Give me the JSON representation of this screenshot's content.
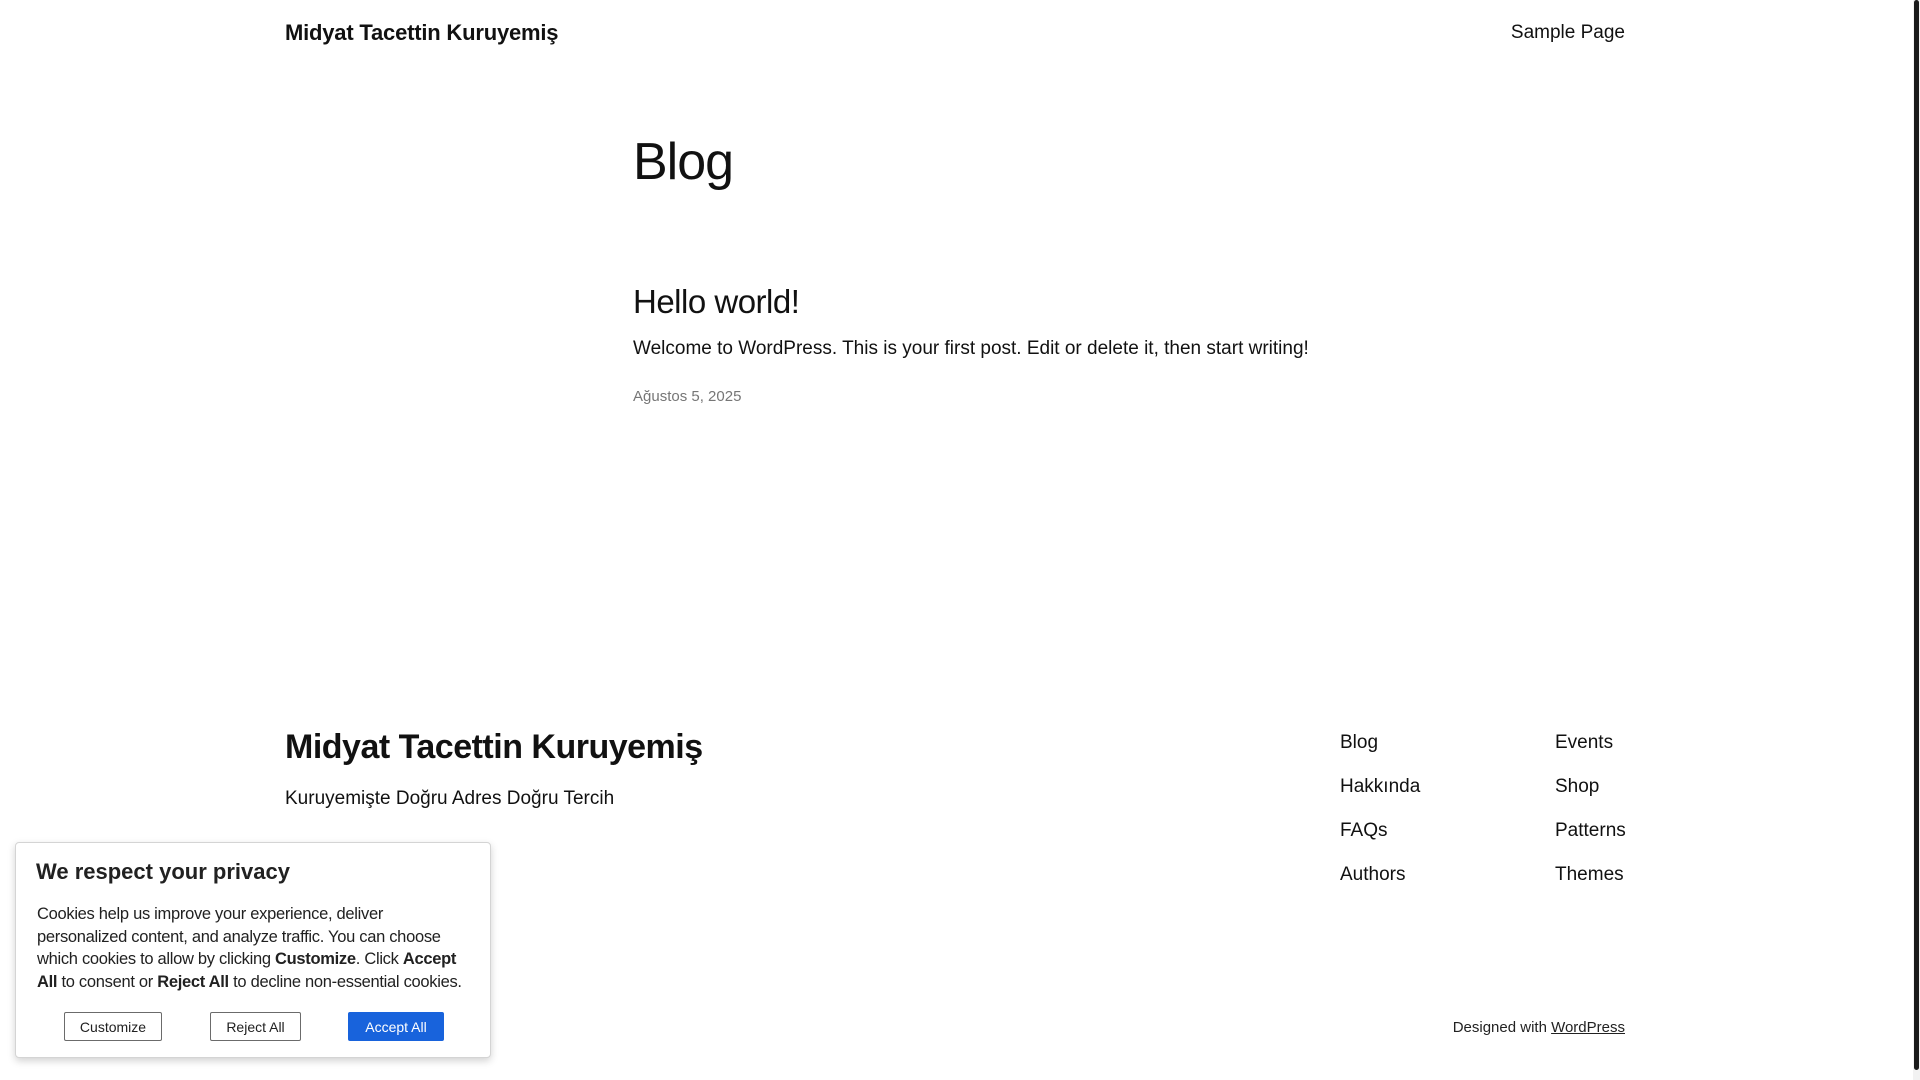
{
  "header": {
    "site_title": "Midyat Tacettin Kuruyemiş",
    "nav": [
      "Sample Page"
    ]
  },
  "main": {
    "page_title": "Blog",
    "post": {
      "title": "Hello world!",
      "excerpt": "Welcome to WordPress. This is your first post. Edit or delete it, then start writing!",
      "date": "Ağustos 5, 2025"
    }
  },
  "footer": {
    "site_title": "Midyat Tacettin Kuruyemiş",
    "tagline": "Kuruyemişte Doğru Adres Doğru Tercih",
    "col1": [
      "Blog",
      "Hakkında",
      "FAQs",
      "Authors"
    ],
    "col2": [
      "Events",
      "Shop",
      "Patterns",
      "Themes"
    ],
    "credit_prefix": "Designed with ",
    "credit_link": "WordPress"
  },
  "cookie": {
    "title": "We respect your privacy",
    "text_1": "Cookies help us improve your experience, deliver personalized content, and analyze traffic. You can choose which cookies to allow by clicking ",
    "em_customize": "Customize",
    "text_2": ". Click ",
    "em_accept": "Accept All",
    "text_3": " to consent or ",
    "em_reject": "Reject All",
    "text_4": " to decline non-essential cookies.",
    "btn_customize": "Customize",
    "btn_reject": "Reject All",
    "btn_accept": "Accept All",
    "accent_color": "#1863dc"
  }
}
